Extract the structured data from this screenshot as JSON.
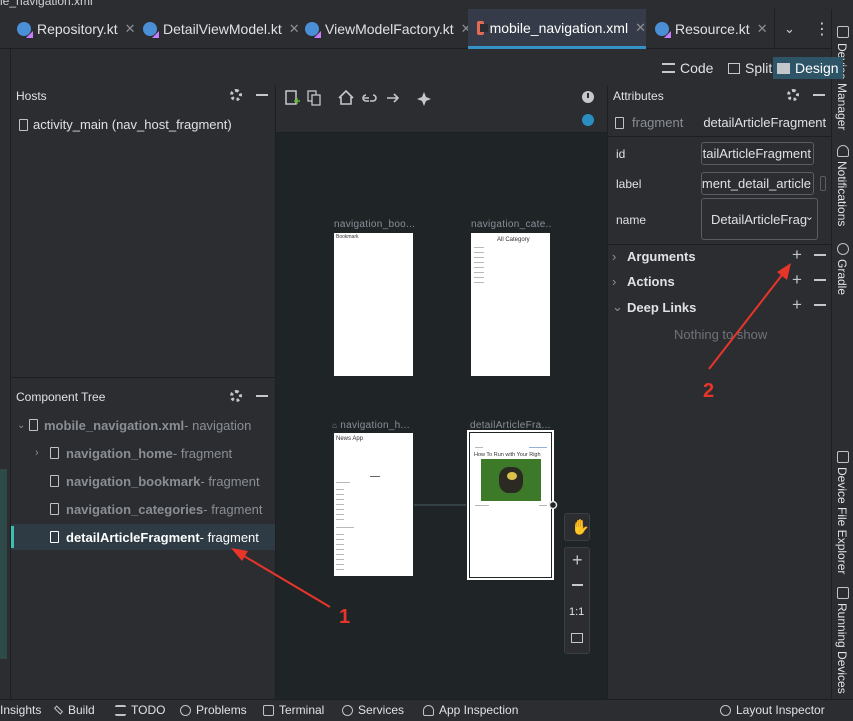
{
  "window": {
    "title": "le_navigation.xml"
  },
  "tabs": [
    {
      "label": "Repository.kt",
      "icon": "kotlin-file-icon"
    },
    {
      "label": "DetailViewModel.kt",
      "icon": "kotlin-file-icon"
    },
    {
      "label": "ViewModelFactory.kt",
      "icon": "kotlin-file-icon"
    },
    {
      "label": "mobile_navigation.xml",
      "icon": "xml-file-icon",
      "active": true
    },
    {
      "label": "Resource.kt",
      "icon": "kotlin-file-icon"
    }
  ],
  "view_modes": {
    "code": "Code",
    "split": "Split",
    "design": "Design",
    "selected": "Design"
  },
  "hosts": {
    "title": "Hosts",
    "items": [
      "activity_main (nav_host_fragment)"
    ]
  },
  "component_tree": {
    "title": "Component Tree",
    "root": {
      "name": "mobile_navigation.xml",
      "suffix": " - navigation"
    },
    "items": [
      {
        "name": "navigation_home",
        "suffix": " - fragment",
        "expandable": true
      },
      {
        "name": "navigation_bookmark",
        "suffix": " - fragment"
      },
      {
        "name": "navigation_categories",
        "suffix": " - fragment"
      },
      {
        "name": "detailArticleFragment",
        "suffix": " - fragment",
        "selected": true
      }
    ]
  },
  "canvas": {
    "destinations": [
      {
        "title": "navigation_boo...",
        "content": "Bookmark"
      },
      {
        "title": "navigation_cate...",
        "content": "All Category"
      },
      {
        "title": "navigation_h...",
        "content": "News App",
        "start": true
      },
      {
        "title": "detailArticleFra...",
        "content": "How To Run with Your Righ",
        "selected": true
      }
    ],
    "zoom_controls": {
      "fit_label": "1:1"
    }
  },
  "attributes": {
    "title": "Attributes",
    "kind": "fragment",
    "name": "detailArticleFragment",
    "fields": [
      {
        "label": "id",
        "value": "tailArticleFragment"
      },
      {
        "label": "label",
        "value": "gment_detail_article"
      },
      {
        "label": "name",
        "value": "DetailArticleFrag"
      }
    ],
    "sections": [
      "Arguments",
      "Actions",
      "Deep Links"
    ],
    "empty_text": "Nothing to show"
  },
  "right_tools": [
    "Device Manager",
    "Notifications",
    "Gradle",
    "Device File Explorer",
    "Running Devices"
  ],
  "status_bar": [
    "Insights",
    "Build",
    "TODO",
    "Problems",
    "Terminal",
    "Services",
    "App Inspection",
    "Layout Inspector"
  ],
  "annotations": [
    {
      "label": "1",
      "color": "#e8352a"
    },
    {
      "label": "2",
      "color": "#e8352a"
    }
  ]
}
